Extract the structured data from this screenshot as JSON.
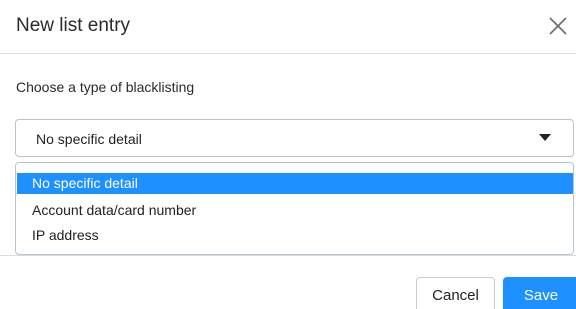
{
  "dialog": {
    "title": "New list entry",
    "close_icon": "close-icon"
  },
  "form": {
    "prompt": "Choose a type of blacklisting",
    "select": {
      "value": "No specific detail",
      "caret_icon": "caret-down-icon"
    },
    "options": [
      {
        "label": "No specific detail",
        "selected": true
      },
      {
        "label": "Account data/card number",
        "selected": false
      },
      {
        "label": "IP address",
        "selected": false
      }
    ]
  },
  "footer": {
    "cancel_label": "Cancel",
    "save_label": "Save"
  },
  "colors": {
    "accent": "#1e90ff",
    "border": "#b9c3cc",
    "divider": "#d6dde3"
  }
}
